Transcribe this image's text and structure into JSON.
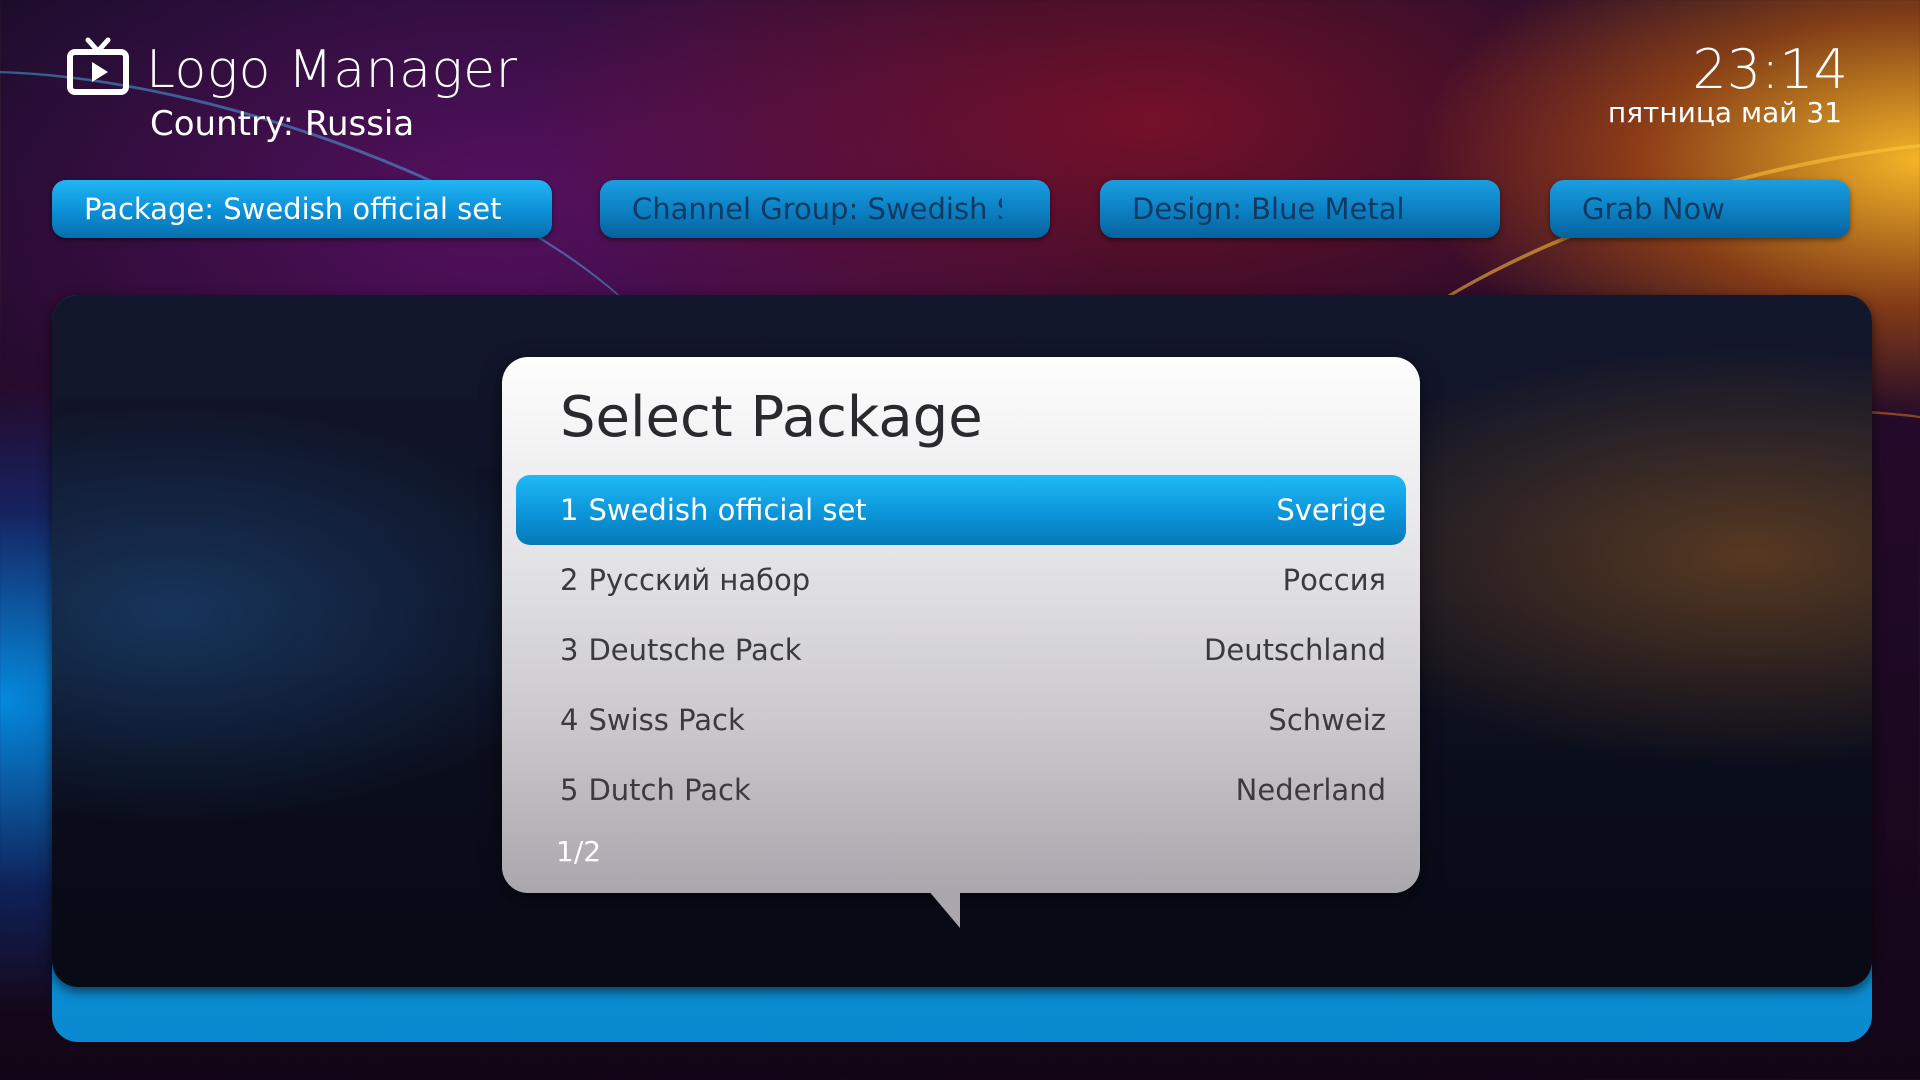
{
  "header": {
    "app_title": "Logo Manager",
    "country": "Country: Russia",
    "time": "23:14",
    "date": "пятница май 31",
    "icon": "tv-icon"
  },
  "top_buttons": [
    {
      "label": "Package: Swedish official set",
      "state": "focused"
    },
    {
      "label": "Channel Group: Swedish Spo",
      "state": "normal"
    },
    {
      "label": "Design: Blue Metal",
      "state": "normal"
    },
    {
      "label": "Grab Now",
      "state": "normal"
    }
  ],
  "dialog": {
    "title": "Select Package",
    "items": [
      {
        "number": "1",
        "name": "Swedish official set",
        "country": "Sverige",
        "selected": true
      },
      {
        "number": "2",
        "name": "Русский набор",
        "country": "Россия",
        "selected": false
      },
      {
        "number": "3",
        "name": "Deutsche Pack",
        "country": "Deutschland",
        "selected": false
      },
      {
        "number": "4",
        "name": "Swiss Pack",
        "country": "Schweiz",
        "selected": false
      },
      {
        "number": "5",
        "name": "Dutch Pack",
        "country": "Nederland",
        "selected": false
      }
    ],
    "pager": "1/2"
  },
  "colors": {
    "accent": "#0c95da",
    "accent_light": "#1fbaf5",
    "dim_text": "#0f3b62",
    "dialog_text": "#3b3a3f"
  }
}
